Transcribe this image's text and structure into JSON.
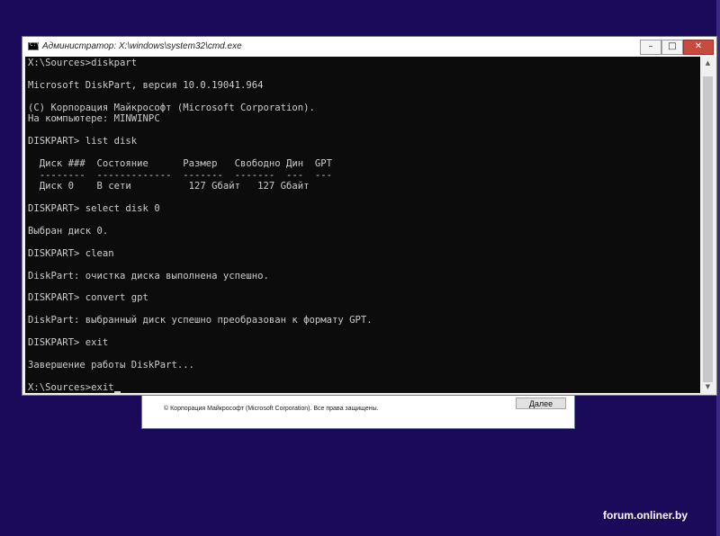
{
  "setup": {
    "copyright": "© Корпорация Майкрософт (Microsoft Corporation). Все права защищены.",
    "next_label": "Далее"
  },
  "cmd": {
    "title": "Администратор: X:\\windows\\system32\\cmd.exe",
    "icon_label": "C:\\",
    "buttons": {
      "minimize": "–",
      "maximize": "□",
      "close": "✕"
    },
    "lines": [
      "X:\\Sources>diskpart",
      "",
      "Microsoft DiskPart, версия 10.0.19041.964",
      "",
      "(C) Корпорация Майкрософт (Microsoft Corporation).",
      "На компьютере: MINWINPC",
      "",
      "DISKPART> list disk",
      "",
      "  Диск ###  Состояние      Размер   Свободно Дин  GPT",
      "  --------  -------------  -------  -------  ---  ---",
      "  Диск 0    В сети          127 Gбайт   127 Gбайт",
      "",
      "DISKPART> select disk 0",
      "",
      "Выбран диск 0.",
      "",
      "DISKPART> clean",
      "",
      "DiskPart: очистка диска выполнена успешно.",
      "",
      "DISKPART> convert gpt",
      "",
      "DiskPart: выбранный диск успешно преобразован к формату GPT.",
      "",
      "DISKPART> exit",
      "",
      "Завершение работы DiskPart...",
      "",
      "X:\\Sources>exit"
    ]
  },
  "watermark": "forum.onliner.by",
  "colors": {
    "desktop": "#1b0a5a",
    "console_bg": "#0c0c0c",
    "console_text": "#cccccc",
    "close_button": "#c74b3e"
  }
}
